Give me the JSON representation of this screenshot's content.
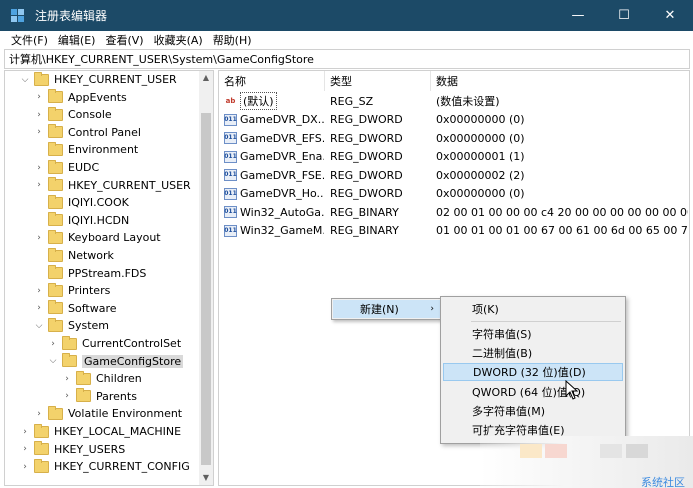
{
  "window": {
    "title": "注册表编辑器",
    "controls": {
      "minimize": "—",
      "maximize": "☐",
      "close": "✕"
    }
  },
  "menubar": [
    "文件(F)",
    "编辑(E)",
    "查看(V)",
    "收藏夹(A)",
    "帮助(H)"
  ],
  "address": "计算机\\HKEY_CURRENT_USER\\System\\GameConfigStore",
  "tree": [
    {
      "label": "HKEY_CURRENT_USER",
      "depth": 0,
      "arrow": "⌵"
    },
    {
      "label": "AppEvents",
      "depth": 1,
      "arrow": "›"
    },
    {
      "label": "Console",
      "depth": 1,
      "arrow": "›"
    },
    {
      "label": "Control Panel",
      "depth": 1,
      "arrow": "›"
    },
    {
      "label": "Environment",
      "depth": 1,
      "arrow": ""
    },
    {
      "label": "EUDC",
      "depth": 1,
      "arrow": "›"
    },
    {
      "label": "HKEY_CURRENT_USER",
      "depth": 1,
      "arrow": "›"
    },
    {
      "label": "IQIYI.COOK",
      "depth": 1,
      "arrow": ""
    },
    {
      "label": "IQIYI.HCDN",
      "depth": 1,
      "arrow": ""
    },
    {
      "label": "Keyboard Layout",
      "depth": 1,
      "arrow": "›"
    },
    {
      "label": "Network",
      "depth": 1,
      "arrow": ""
    },
    {
      "label": "PPStream.FDS",
      "depth": 1,
      "arrow": ""
    },
    {
      "label": "Printers",
      "depth": 1,
      "arrow": "›"
    },
    {
      "label": "Software",
      "depth": 1,
      "arrow": "›"
    },
    {
      "label": "System",
      "depth": 1,
      "arrow": "⌵"
    },
    {
      "label": "CurrentControlSet",
      "depth": 2,
      "arrow": "›"
    },
    {
      "label": "GameConfigStore",
      "depth": 2,
      "arrow": "⌵",
      "selected": true
    },
    {
      "label": "Children",
      "depth": 3,
      "arrow": "›"
    },
    {
      "label": "Parents",
      "depth": 3,
      "arrow": "›"
    },
    {
      "label": "Volatile Environment",
      "depth": 1,
      "arrow": "›"
    },
    {
      "label": "HKEY_LOCAL_MACHINE",
      "depth": 0,
      "arrow": "›"
    },
    {
      "label": "HKEY_USERS",
      "depth": 0,
      "arrow": "›"
    },
    {
      "label": "HKEY_CURRENT_CONFIG",
      "depth": 0,
      "arrow": "›"
    }
  ],
  "columns": {
    "name": "名称",
    "type": "类型",
    "data": "数据"
  },
  "values": [
    {
      "icon": "string-value-icon",
      "glyph": "ab",
      "name": "(默认)",
      "type": "REG_SZ",
      "data": "(数值未设置)"
    },
    {
      "icon": "binary-value-icon",
      "glyph": "011",
      "name": "GameDVR_DX...",
      "type": "REG_DWORD",
      "data": "0x00000000 (0)"
    },
    {
      "icon": "binary-value-icon",
      "glyph": "011",
      "name": "GameDVR_EFS...",
      "type": "REG_DWORD",
      "data": "0x00000000 (0)"
    },
    {
      "icon": "binary-value-icon",
      "glyph": "011",
      "name": "GameDVR_Ena...",
      "type": "REG_DWORD",
      "data": "0x00000001 (1)"
    },
    {
      "icon": "binary-value-icon",
      "glyph": "011",
      "name": "GameDVR_FSE...",
      "type": "REG_DWORD",
      "data": "0x00000002 (2)"
    },
    {
      "icon": "binary-value-icon",
      "glyph": "011",
      "name": "GameDVR_Ho...",
      "type": "REG_DWORD",
      "data": "0x00000000 (0)"
    },
    {
      "icon": "binary-value-icon",
      "glyph": "011",
      "name": "Win32_AutoGa...",
      "type": "REG_BINARY",
      "data": "02 00 01 00 00 00 c4 20 00 00 00 00 00 00 00..."
    },
    {
      "icon": "binary-value-icon",
      "glyph": "011",
      "name": "Win32_GameM...",
      "type": "REG_BINARY",
      "data": "01 00 01 00 01 00 67 00 61 00 6d 00 65 00 70..."
    }
  ],
  "context_menu": {
    "new_label": "新建(N)",
    "sub_arrow": "›",
    "submenu": [
      {
        "label": "项(K)"
      },
      {
        "label": "字符串值(S)"
      },
      {
        "label": "二进制值(B)"
      },
      {
        "label": "DWORD (32 位)值(D)",
        "highlight": true
      },
      {
        "label": "QWORD (64 位)值(Q)"
      },
      {
        "label": "多字符串值(M)"
      },
      {
        "label": "可扩充字符串值(E)"
      }
    ]
  },
  "watermark": "系统社区",
  "colors": {
    "titlebar": "#1c4a67",
    "menu_highlight": "#cce4f7",
    "watermark": "#3d8be0"
  }
}
